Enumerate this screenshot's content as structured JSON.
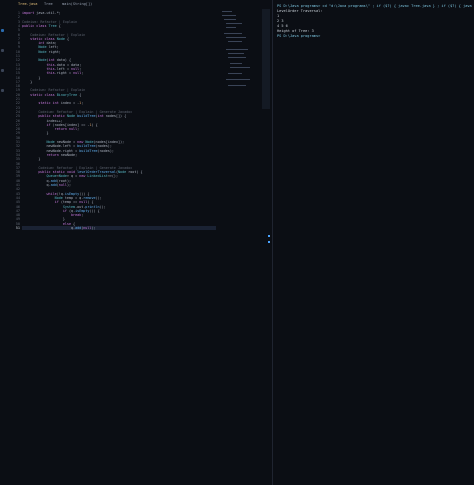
{
  "breadcrumb": {
    "file": "Tree.java",
    "path": "Tree",
    "method": "main(String[])"
  },
  "editor": {
    "active_line": 51,
    "lines": [
      {
        "n": 1,
        "t": "import java.util.*;"
      },
      {
        "n": 2,
        "t": ""
      },
      {
        "n": 3,
        "t": "Codeium: Refactor | Explain"
      },
      {
        "n": 4,
        "t": "public class Tree {"
      },
      {
        "n": 5,
        "t": ""
      },
      {
        "n": 6,
        "t": "    Codeium: Refactor | Explain"
      },
      {
        "n": 7,
        "t": "    static class Node {"
      },
      {
        "n": 8,
        "t": "        int data;"
      },
      {
        "n": 9,
        "t": "        Node left;"
      },
      {
        "n": 10,
        "t": "        Node right;"
      },
      {
        "n": 11,
        "t": ""
      },
      {
        "n": 12,
        "t": "        Node(int data) {"
      },
      {
        "n": 13,
        "t": "            this.data = data;"
      },
      {
        "n": 14,
        "t": "            this.left = null;"
      },
      {
        "n": 15,
        "t": "            this.right = null;"
      },
      {
        "n": 16,
        "t": "        }"
      },
      {
        "n": 17,
        "t": "    }"
      },
      {
        "n": 18,
        "t": ""
      },
      {
        "n": 19,
        "t": "    Codeium: Refactor | Explain"
      },
      {
        "n": 20,
        "t": "    static class BinaryTree {"
      },
      {
        "n": 21,
        "t": ""
      },
      {
        "n": 22,
        "t": "        static int index = -1;"
      },
      {
        "n": 23,
        "t": ""
      },
      {
        "n": 24,
        "t": "        Codeium: Refactor | Explain | Generate Javadoc"
      },
      {
        "n": 25,
        "t": "        public static Node buildTree(int nodes[]) {"
      },
      {
        "n": 26,
        "t": "            index++;"
      },
      {
        "n": 27,
        "t": "            if (nodes[index] == -1) {"
      },
      {
        "n": 28,
        "t": "                return null;"
      },
      {
        "n": 29,
        "t": "            }"
      },
      {
        "n": 30,
        "t": ""
      },
      {
        "n": 31,
        "t": "            Node newNode = new Node(nodes[index]);"
      },
      {
        "n": 32,
        "t": "            newNode.left = buildTree(nodes);"
      },
      {
        "n": 33,
        "t": "            newNode.right = buildTree(nodes);"
      },
      {
        "n": 34,
        "t": "            return newNode;"
      },
      {
        "n": 35,
        "t": "        }"
      },
      {
        "n": 36,
        "t": ""
      },
      {
        "n": 37,
        "t": "        Codeium: Refactor | Explain | Generate Javadoc"
      },
      {
        "n": 38,
        "t": "        public static void levelOrderTraversal(Node root) {"
      },
      {
        "n": 39,
        "t": "            Queue<Node> q = new LinkedList<>();"
      },
      {
        "n": 40,
        "t": "            q.add(root);"
      },
      {
        "n": 41,
        "t": "            q.add(null);"
      },
      {
        "n": 42,
        "t": ""
      },
      {
        "n": 43,
        "t": "            while(!q.isEmpty()) {"
      },
      {
        "n": 44,
        "t": "                Node temp = q.remove();"
      },
      {
        "n": 45,
        "t": "                if (temp == null) {"
      },
      {
        "n": 46,
        "t": "                    System.out.println();"
      },
      {
        "n": 47,
        "t": "                    if (q.isEmpty()) {"
      },
      {
        "n": 48,
        "t": "                        break;"
      },
      {
        "n": 49,
        "t": "                    }"
      },
      {
        "n": 50,
        "t": "                    else {"
      },
      {
        "n": 51,
        "t": "                        q.add(null);"
      }
    ]
  },
  "terminal": {
    "lines": [
      "PS D:\\Java programs> cd \"d:\\Java programs\\\" ; if ($?) { javac Tree.java } ; if ($?) { java Tree }",
      "LevelOrder Traversal:",
      "1",
      "2 3",
      "4 5 6",
      "Height of Tree: 3",
      "PS D:\\Java programs>"
    ]
  }
}
